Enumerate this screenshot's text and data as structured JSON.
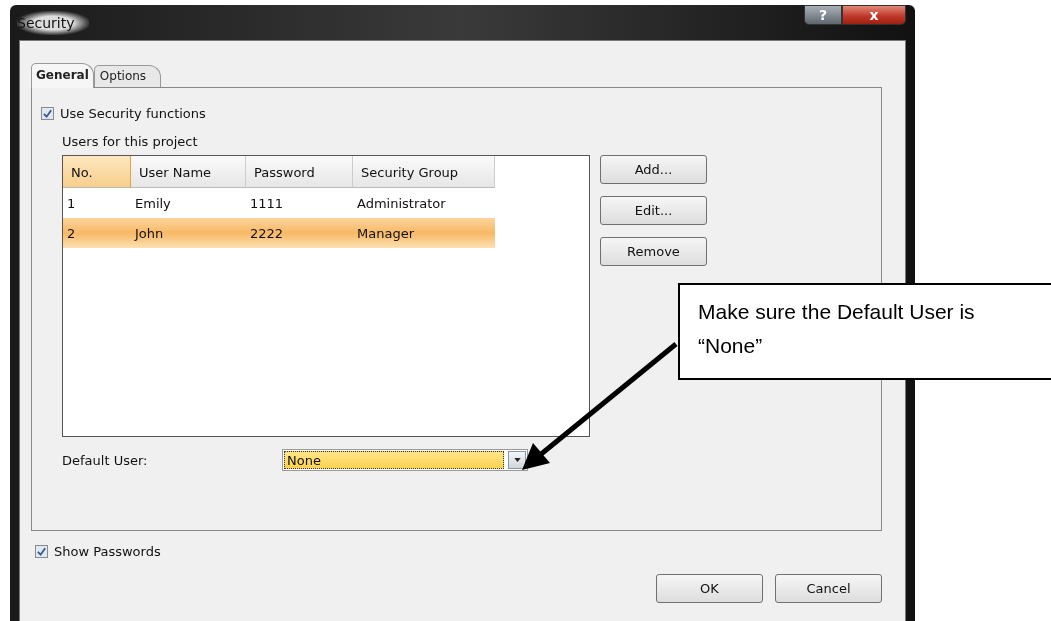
{
  "window": {
    "title": "Security",
    "help_button": "?",
    "close_button": "x"
  },
  "tabs": [
    {
      "label": "General",
      "selected": true
    },
    {
      "label": "Options",
      "selected": false
    }
  ],
  "use_security": {
    "label": "Use Security functions",
    "checked": true
  },
  "users_label": "Users for this project",
  "table": {
    "columns": [
      {
        "label": "No.",
        "highlighted": true
      },
      {
        "label": "User Name",
        "highlighted": false
      },
      {
        "label": "Password",
        "highlighted": false
      },
      {
        "label": "Security Group",
        "highlighted": false
      }
    ],
    "rows": [
      {
        "cells": [
          "1",
          "Emily",
          "1111",
          "Administrator"
        ],
        "selected": false
      },
      {
        "cells": [
          "2",
          "John",
          "2222",
          "Manager"
        ],
        "selected": true
      }
    ]
  },
  "side_buttons": [
    "Add...",
    "Edit...",
    "Remove"
  ],
  "default_user": {
    "label": "Default User:",
    "value": "None"
  },
  "show_passwords": {
    "label": "Show Passwords",
    "checked": true
  },
  "buttons": [
    "OK",
    "Cancel"
  ],
  "callout": {
    "text": "Make sure the Default User is “None”"
  }
}
